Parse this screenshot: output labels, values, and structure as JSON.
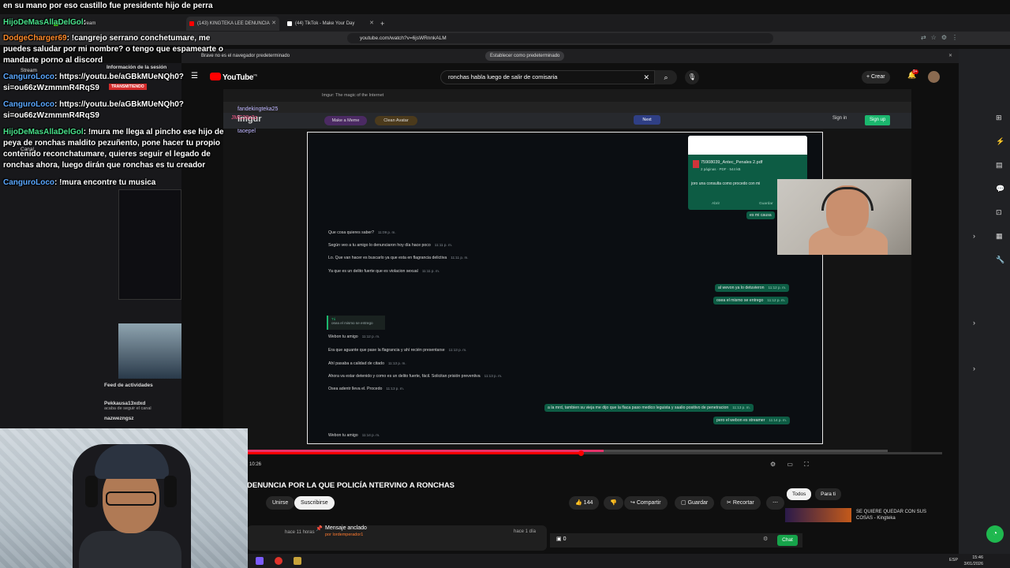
{
  "overlay": {
    "top_line": "en su mano por eso castillo fue presidente hijo de perra",
    "chat": [
      {
        "user": "HijoDeMasAllaDelGol",
        "sep": ": ",
        "text": "",
        "color": "#48e08a"
      },
      {
        "user": "DodgeCharger69",
        "sep": ": ",
        "text": "!cangrejo serrano conchetumare, me puedes saludar por mi nombre? o tengo que espamearte o mandarte porno al discord",
        "color": "#ff8a2a"
      },
      {
        "user": "CanguroLoco",
        "sep": ": ",
        "text": "https://youtu.be/aGBkMUeNQh0?si=ou66zWzmmmR4RqS9",
        "color": "#5aa7ff"
      },
      {
        "user": "CanguroLoco",
        "sep": ": ",
        "text": "https://youtu.be/aGBkMUeNQh0?si=ou66zWzmmmR4RqS9",
        "color": "#5aa7ff"
      },
      {
        "user": "HijoDeMasAllaDelGol",
        "sep": ": ",
        "text": "!mura me llega al pincho ese hijo de peya de ronchas maldito pezuñento, pone hacer tu propio contenido reconchatumare, quieres seguir el legado de ronchas ahora, luego dirán que ronchas es tu creador",
        "color": "#48e08a"
      },
      {
        "user": "CanguroLoco",
        "sep": ": ",
        "text": "!mura encontre tu musica",
        "color": "#5aa7ff"
      }
    ],
    "left_panel": {
      "session_info": "Información de la sesión",
      "stream_label": "Stream",
      "live_badge": "TRANSMITIENDO",
      "channel": "Canal",
      "activity_title": "Feed de actividades",
      "activity": [
        {
          "user": "Pekkausa13xdxd",
          "action": "acaba de seguir el canal"
        },
        {
          "user": "nazwezngsz",
          "action": ""
        }
      ]
    }
  },
  "browser": {
    "tabs": [
      {
        "label": "(143) KINGTEKA LEE DENUNCIA",
        "color": "#ff0000"
      },
      {
        "label": "(44) TikTok - Make Your Day",
        "color": "#ffffff"
      }
    ],
    "url": "youtube.com/watch?v=6jsWRnnkALM",
    "infobar_text": "Brave no es el navegador predeterminado",
    "infobar_button": "Establecer como predeterminado",
    "kick_url": "kick.com/stream"
  },
  "youtube": {
    "logo": "YouTube",
    "region": "PE",
    "search_query": "ronchas habla luego de salir de comisaria",
    "create_label": "Crear",
    "notifications": "9+",
    "video_title": "DENUNCIA POR LA QUE POLICÍA NTERVINO A RONCHAS",
    "join_label": "Unirse",
    "subscribe_label": "Suscribirse",
    "likes": "144",
    "share_label": "Compartir",
    "save_label": "Guardar",
    "clip_label": "Recortar",
    "time_ago": "hace 11 horas",
    "pinned_title": "Mensaje anclado",
    "pinned_by": "por lordemperador1",
    "pinned_ago": "hace 1 día",
    "chat_count": "0",
    "chat_button": "Chat",
    "filters": [
      "Todos",
      "Para ti"
    ],
    "rec_title": "SE QUIERE QUEDAR CON SUS COSAS - Kingteka",
    "current_time": "10:26",
    "progress": 0.48
  },
  "video_content": {
    "inner_tabs": [
      "Imgur: The magic of the Internet"
    ],
    "imgur_logo": "imgur",
    "make_meme": "Make a Meme",
    "clean_button": "Clean Avatar",
    "next_label": "Next",
    "sign_in": "Sign in",
    "sign_up": "Sign up",
    "stream_chat": [
      {
        "user": "fandekingteka25",
        "text": ""
      },
      {
        "user": "JMC28z2z",
        "text": ""
      },
      {
        "user": "taoepel",
        "text": ""
      }
    ],
    "pdf": {
      "name": "75908039_Antec_Penales 2.pdf",
      "meta": "2 páginas · PDF · 544 kB",
      "message": "joro una consulta como procedo con mi",
      "open": "Abrir",
      "save": "Guardar",
      "reply": "es mi causa"
    },
    "incoming": [
      {
        "text": "Que cosa quieres saber?",
        "time": "11:09 p. m."
      },
      {
        "text": "Según veo a tu amigo lo denunciaron hoy día hace poco",
        "time": "11:11 p. m."
      },
      {
        "text": "Lo. Que van  hacer es buscarlo ya que esta en flagrancia delictiva",
        "time": "11:11 p. m."
      },
      {
        "text": "Ya que es un delito fuerte que es violacion sexual",
        "time": "11:11 p. m."
      }
    ],
    "outgoing": [
      {
        "text": "al wevon ya lo detuvieron",
        "time": "11:12 p. m."
      },
      {
        "text": "osea el mismo se entrego",
        "time": "11:12 p. m."
      }
    ],
    "quote_author": "Tú",
    "quote_text": "osea el mismo se entrego",
    "incoming2": [
      {
        "text": "Webon tu amigo",
        "time": "11:12 p. m."
      },
      {
        "text": "Era que aguante que pase la flagrancia y ahí recién presentarse",
        "time": "11:13 p. m."
      },
      {
        "text": "Ahí pasaba a calidad de citado",
        "time": "11:13 p. m."
      },
      {
        "text": "Ahora va estar detenido y como es un delito fuerte, fácil. Solicitan prisión preventiva",
        "time": "11:13 p. m."
      },
      {
        "text": "Osea adentr lleva el. Procedo",
        "time": "11:13 p. m."
      }
    ],
    "outgoing2": [
      {
        "text": "a la mrd, tambien su vieja me dijo que la flaca paso medico leguista y saalio positivo de penetracion",
        "time": "11:13 p. m."
      },
      {
        "text": "pero el webon es streamer",
        "time": "11:14 p. m."
      }
    ],
    "last_incoming": {
      "text": "Webon tu amigo",
      "time": "11:14 p. m."
    }
  },
  "taskbar": {
    "time": "15:46",
    "date": "3/01/2026",
    "lang": "ESP"
  }
}
